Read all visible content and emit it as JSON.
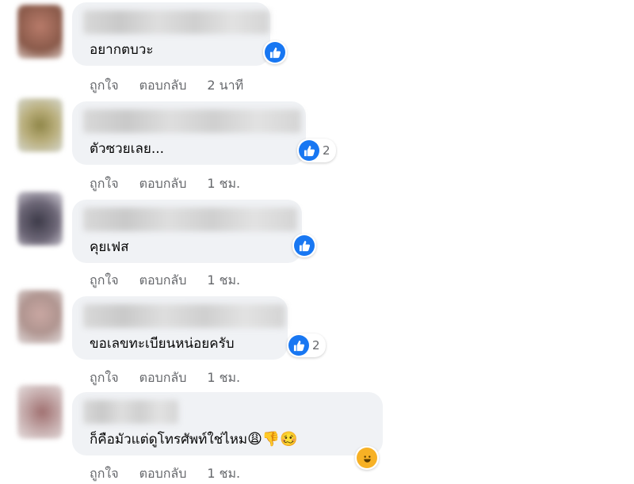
{
  "comments": [
    {
      "text": "อยากตบวะ",
      "reaction_count": "",
      "like": "ถูกใจ",
      "reply": "ตอบกลับ",
      "time": "2 นาที"
    },
    {
      "text": "ตัวซวยเลย...",
      "reaction_count": "2",
      "like": "ถูกใจ",
      "reply": "ตอบกลับ",
      "time": "1 ชม."
    },
    {
      "text": "คุยเฟส",
      "reaction_count": "",
      "like": "ถูกใจ",
      "reply": "ตอบกลับ",
      "time": "1 ชม."
    },
    {
      "text": "ขอเลขทะเบียนหน่อยครับ",
      "reaction_count": "2",
      "like": "ถูกใจ",
      "reply": "ตอบกลับ",
      "time": "1 ชม."
    },
    {
      "text": "ก็คือมัวแต่ดูโทรศัพท์ใช่ไหม",
      "emojis": "😩👎🥴",
      "reaction_count": "",
      "like": "ถูกใจ",
      "reply": "ตอบกลับ",
      "time": "1 ชม."
    }
  ],
  "reaction_icon": "like-thumbs-up",
  "reaction_icon_extra": "haha-face",
  "colors": {
    "bubble": "#f0f2f5",
    "meta": "#65676b",
    "like_blue": "#1877f2"
  }
}
